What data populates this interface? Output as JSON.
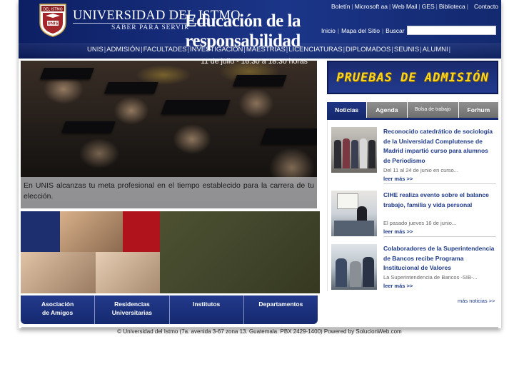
{
  "header": {
    "university_name": "UNIVERSIDAD DEL ISTMO",
    "motto": "SABER PARA SERVIR",
    "crest": {
      "top_text": "DEL ISTMO",
      "mid_text": "UNIS"
    },
    "top_links": [
      "Boletín",
      "Microsoft aa",
      "Web Mail",
      "GES",
      "Biblioteca",
      "Contacto"
    ],
    "util_links": [
      "Inicio",
      "Mapa del Sitio",
      "Buscar"
    ],
    "search_value": ""
  },
  "mainnav": [
    "UNIS",
    "ADMISIÓN",
    "FACULTADES",
    "INVESTIGACIÓN",
    "MAESTRÍAS",
    "LICENCIATURAS",
    "DIPLOMADOS",
    "SEUNIS",
    "ALUMNI"
  ],
  "hero": {
    "caption": "En UNIS alcanzas tu meta profesional en el tiempo establecido para la carrera de tu elección."
  },
  "banner": {
    "title_line1": "Educación de la",
    "title_line2": "responsabilidad",
    "date": "11 de julio - 16:30 a 18:30 horas"
  },
  "bottom_tabs": [
    {
      "line1": "Asociación",
      "line2": "de Amigos"
    },
    {
      "line1": "Residencias",
      "line2": "Universitarias"
    },
    {
      "line1": "Institutos",
      "line2": ""
    },
    {
      "line1": "Departamentos",
      "line2": ""
    }
  ],
  "admision_banner": "PRUEBAS DE ADMISIÓN",
  "news_tabs": [
    {
      "label": "Noticias"
    },
    {
      "label": "Agenda"
    },
    {
      "label": "Bolsa de trabajo"
    },
    {
      "label": "Forhum"
    }
  ],
  "news": [
    {
      "title": "Reconocido catedrático de sociología de la Universidad Complutense de Madrid impartió curso para alumnos de Periodismo",
      "snippet": "Del 11 al 24 de junio en curso...",
      "more": "leer más >>"
    },
    {
      "title": "CIHE realiza evento sobre el balance trabajo, familia y vida personal",
      "snippet": "El pasado jueves 16 de junio...",
      "more": "leer más >>"
    },
    {
      "title": "Colaboradores de la Superintendencia de Bancos recibe Programa Institucional de Valores",
      "snippet": "La Superintendencia de Bancos -SIB-...",
      "more": "leer más >>"
    }
  ],
  "more_news": "más noticias >>",
  "footer": "© Universidad del Istmo (7a. avenida 3-67 zona 13. Guatemala. PBX 2429-1400) Powered by SolucionWeb.com",
  "colors": {
    "brand_blue": "#14296f",
    "admision_yellow": "#ffd51e",
    "banner_olive": "#4e5232"
  }
}
